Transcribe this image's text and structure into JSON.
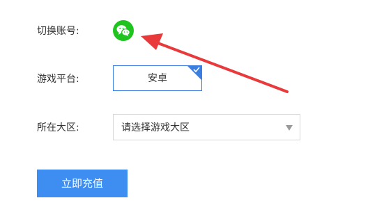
{
  "form": {
    "account_label": "切换账号:",
    "account_icon": "wechat-icon",
    "platform_label": "游戏平台:",
    "platform_value": "安卓",
    "server_label": "所在大区:",
    "server_placeholder": "请选择游戏大区",
    "submit_label": "立即充值"
  },
  "colors": {
    "wechat_green": "#1fc41f",
    "accent_blue": "#3a7fe0",
    "button_blue": "#3d8ef0",
    "annotation_red": "#e8393b"
  }
}
